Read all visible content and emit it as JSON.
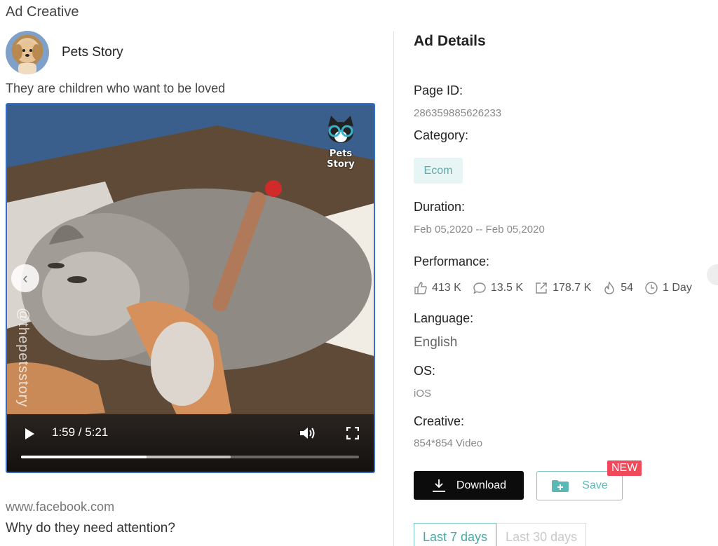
{
  "section_title": "Ad Creative",
  "advertiser": {
    "name": "Pets Story"
  },
  "ad_text": "They are children who want to be loved",
  "video": {
    "watermark_vertical": "@thepetsstory",
    "brand_label": "Pets Story",
    "current_time": "1:59",
    "duration": "5:21",
    "time_display": "1:59 / 5:21",
    "progress_fraction": 0.371,
    "buffered_fraction": 0.62
  },
  "link_domain": "www.facebook.com",
  "headline": "Why do they need attention?",
  "details": {
    "title": "Ad Details",
    "page_id_label": "Page ID:",
    "page_id": "286359885626233",
    "category_label": "Category:",
    "category": "Ecom",
    "duration_label": "Duration:",
    "duration": "Feb 05,2020 -- Feb 05,2020",
    "performance_label": "Performance:",
    "performance": {
      "likes": "413 K",
      "comments": "13.5 K",
      "shares": "178.7 K",
      "heat": "54",
      "days": "1 Day"
    },
    "language_label": "Language:",
    "language": "English",
    "os_label": "OS:",
    "os": "iOS",
    "creative_label": "Creative:",
    "creative": "854*854 Video"
  },
  "actions": {
    "download": "Download",
    "save": "Save",
    "new_badge": "NEW"
  },
  "tabs": [
    "Last 7 days",
    "Last 30 days"
  ],
  "colors": {
    "accent": "#5bb8b4",
    "video_border": "#2f6fd0",
    "badge": "#f04a5a",
    "download_bg": "#0c0c0c"
  }
}
